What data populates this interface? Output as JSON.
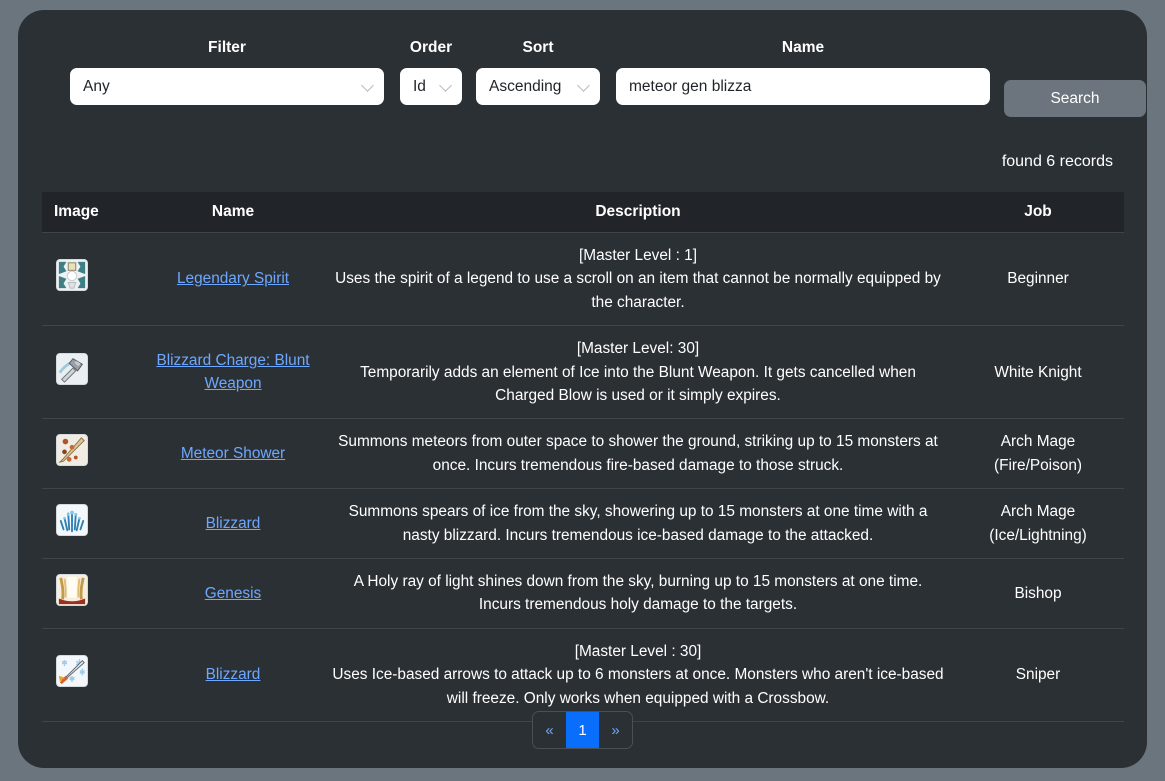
{
  "search_form": {
    "filter": {
      "label": "Filter",
      "value": "Any",
      "icon": "chevron-down-icon"
    },
    "order": {
      "label": "Order",
      "value": "Id",
      "icon": "chevron-down-icon"
    },
    "sort": {
      "label": "Sort",
      "value": "Ascending",
      "icon": "chevron-down-icon"
    },
    "name": {
      "label": "Name",
      "value": "meteor gen blizza",
      "placeholder": ""
    },
    "search_button": "Search"
  },
  "results": {
    "found_text": "found 6 records",
    "columns": [
      "Image",
      "Name",
      "Description",
      "Job"
    ],
    "rows": [
      {
        "icon": "legendary-spirit-icon",
        "name": "Legendary Spirit",
        "master_level": "[Master Level : 1]",
        "description": "Uses the spirit of a legend to use a scroll on an item that cannot be normally equipped by the character.",
        "job": "Beginner",
        "job_sub": ""
      },
      {
        "icon": "blizzard-charge-blunt-weapon-icon",
        "name": "Blizzard Charge: Blunt Weapon",
        "master_level": "[Master Level: 30]",
        "description": "Temporarily adds an element of Ice into the Blunt Weapon. It gets cancelled when Charged Blow is used or it simply expires.",
        "job": "White Knight",
        "job_sub": ""
      },
      {
        "icon": "meteor-shower-icon",
        "name": "Meteor Shower",
        "master_level": "",
        "description": "Summons meteors from outer space to shower the ground, striking up to 15 monsters at once. Incurs tremendous fire-based damage to those struck.",
        "job": "Arch Mage",
        "job_sub": "(Fire/Poison)"
      },
      {
        "icon": "blizzard-icon",
        "name": "Blizzard",
        "master_level": "",
        "description": "Summons spears of ice from the sky, showering up to 15 monsters at one time with a nasty blizzard. Incurs tremendous ice-based damage to the attacked.",
        "job": "Arch Mage",
        "job_sub": "(Ice/Lightning)"
      },
      {
        "icon": "genesis-icon",
        "name": "Genesis",
        "master_level": "",
        "description": "A Holy ray of light shines down from the sky, burning up to 15 monsters at one time. Incurs tremendous holy damage to the targets.",
        "job": "Bishop",
        "job_sub": ""
      },
      {
        "icon": "blizzard-arrow-icon",
        "name": "Blizzard",
        "master_level": "[Master Level : 30]",
        "description": "Uses Ice-based arrows to attack up to 6 monsters at once. Monsters who aren't ice-based will freeze. Only works when equipped with a Crossbow.",
        "job": "Sniper",
        "job_sub": ""
      }
    ]
  },
  "pagination": {
    "prev": "«",
    "next": "»",
    "pages": [
      "1"
    ],
    "active_page": "1"
  },
  "colors": {
    "page_background": "#6b757d",
    "card_background": "#2b3035",
    "table_header_background": "#212529",
    "link": "#6ea8fe",
    "active_page": "#0a6efd",
    "button": "#6c757d",
    "border": "#404549"
  }
}
